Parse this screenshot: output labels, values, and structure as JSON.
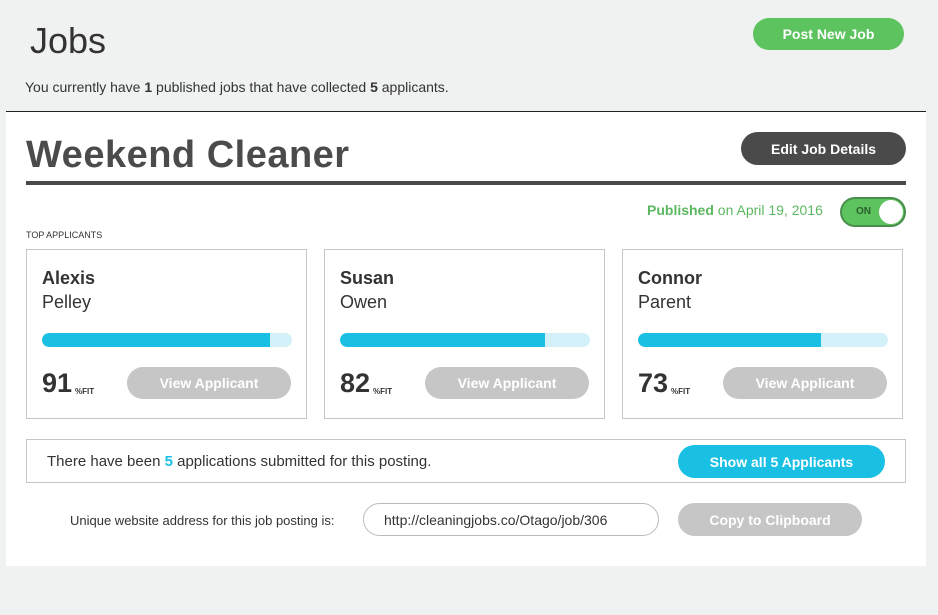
{
  "header": {
    "title": "Jobs",
    "post_button": "Post New Job",
    "summary": {
      "prefix": "You currently have ",
      "published_count": "1",
      "middle": " published jobs that have collected ",
      "applicant_count": "5",
      "suffix": " applicants."
    }
  },
  "job": {
    "title": "Weekend Cleaner",
    "edit_button": "Edit Job Details",
    "status_word": "Published",
    "status_date": " on April 19, 2016",
    "toggle_label": "ON",
    "top_applicants_label": "TOP APPLICANTS",
    "applicants": [
      {
        "first": "Alexis",
        "last": "Pelley",
        "fit": 91,
        "fit_label": "%FIT",
        "button": "View Applicant"
      },
      {
        "first": "Susan",
        "last": "Owen",
        "fit": 82,
        "fit_label": "%FIT",
        "button": "View Applicant"
      },
      {
        "first": "Connor",
        "last": "Parent",
        "fit": 73,
        "fit_label": "%FIT",
        "button": "View Applicant"
      }
    ],
    "applications": {
      "prefix": "There have been ",
      "count": "5",
      "suffix": " applications submitted for this posting.",
      "show_button": "Show all 5 Applicants"
    },
    "url": {
      "label": "Unique website address for this job posting is:",
      "value": "http://cleaningjobs.co/Otago/job/306",
      "copy_button": "Copy to Clipboard"
    }
  },
  "colors": {
    "green": "#5cc35e",
    "cyan": "#1ac0e3",
    "dark": "#4a4a4a",
    "disabled": "#c6c6c6"
  }
}
